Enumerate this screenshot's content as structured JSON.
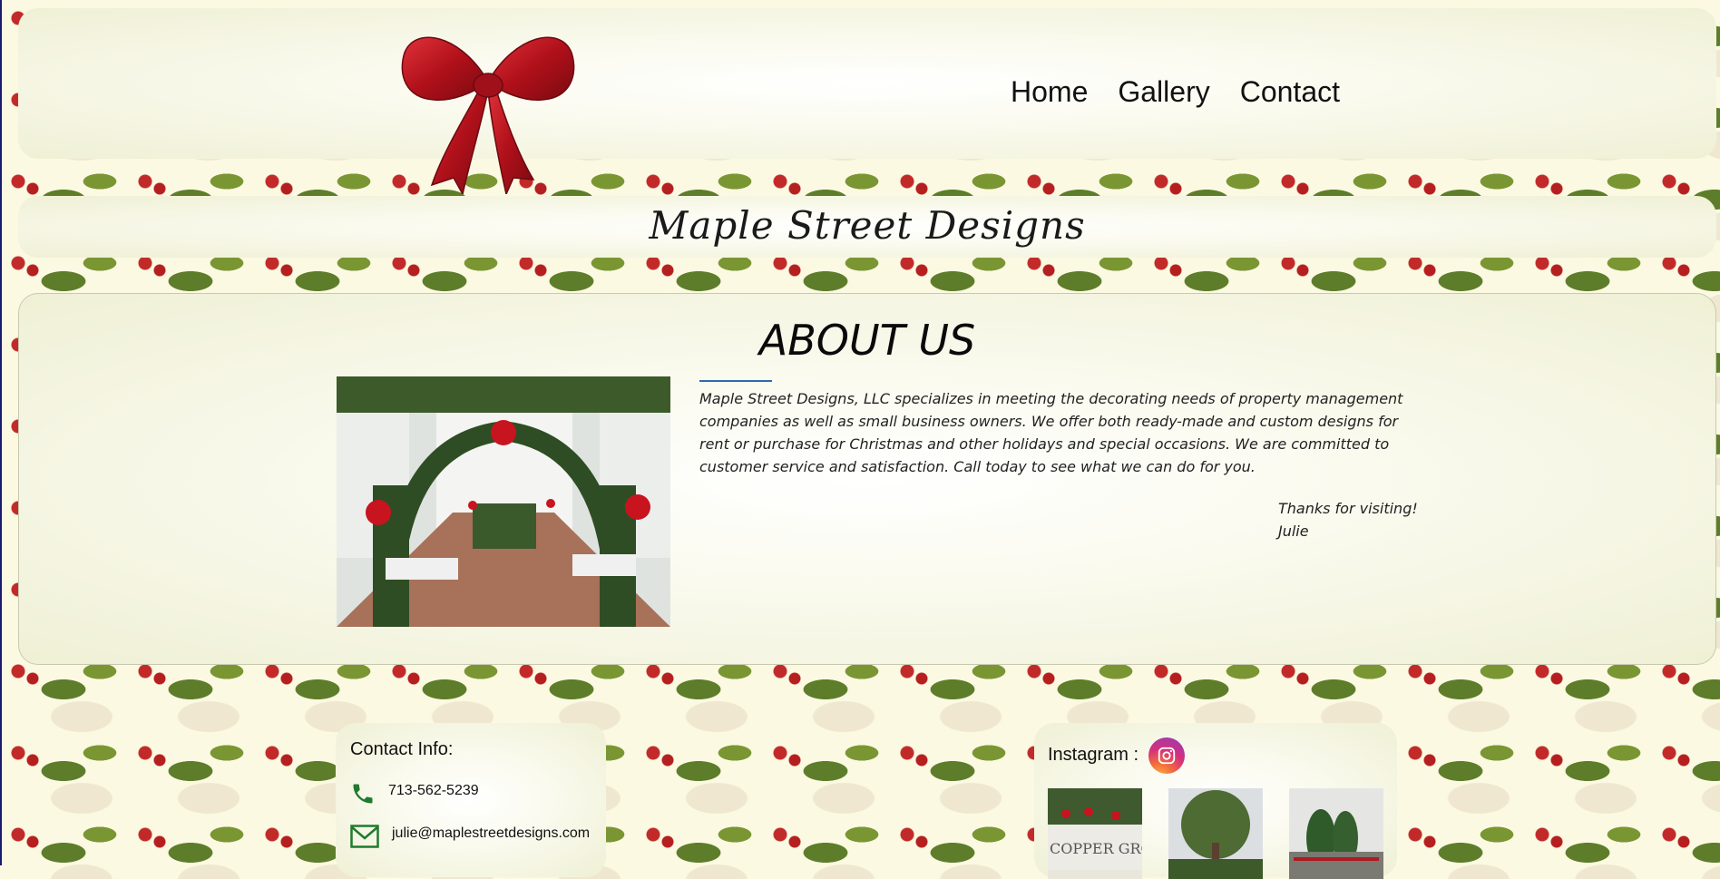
{
  "nav": {
    "items": [
      "Home",
      "Gallery",
      "Contact"
    ]
  },
  "site": {
    "title": "Maple Street Designs"
  },
  "about": {
    "heading": "ABOUT US",
    "body": "Maple Street Designs, LLC specializes in meeting the decorating needs of property management companies as well as small business owners. We offer both ready-made and custom designs for rent or purchase for Christmas and other holidays and special occasions. We are committed to customer service and satisfaction. Call today to see what we can do for you.",
    "signoff_line1": "Thanks for visiting!",
    "signoff_line2": "Julie"
  },
  "contact": {
    "title": "Contact Info:",
    "phone": "713-562-5239",
    "email": "julie@maplestreetdesigns.com"
  },
  "instagram": {
    "label": "Instagram :",
    "thumb1_caption": "COPPER GROV"
  },
  "colors": {
    "accent_rule": "#2b6cb0",
    "icon_green": "#1f7a2e",
    "bow_red": "#c8141f"
  }
}
